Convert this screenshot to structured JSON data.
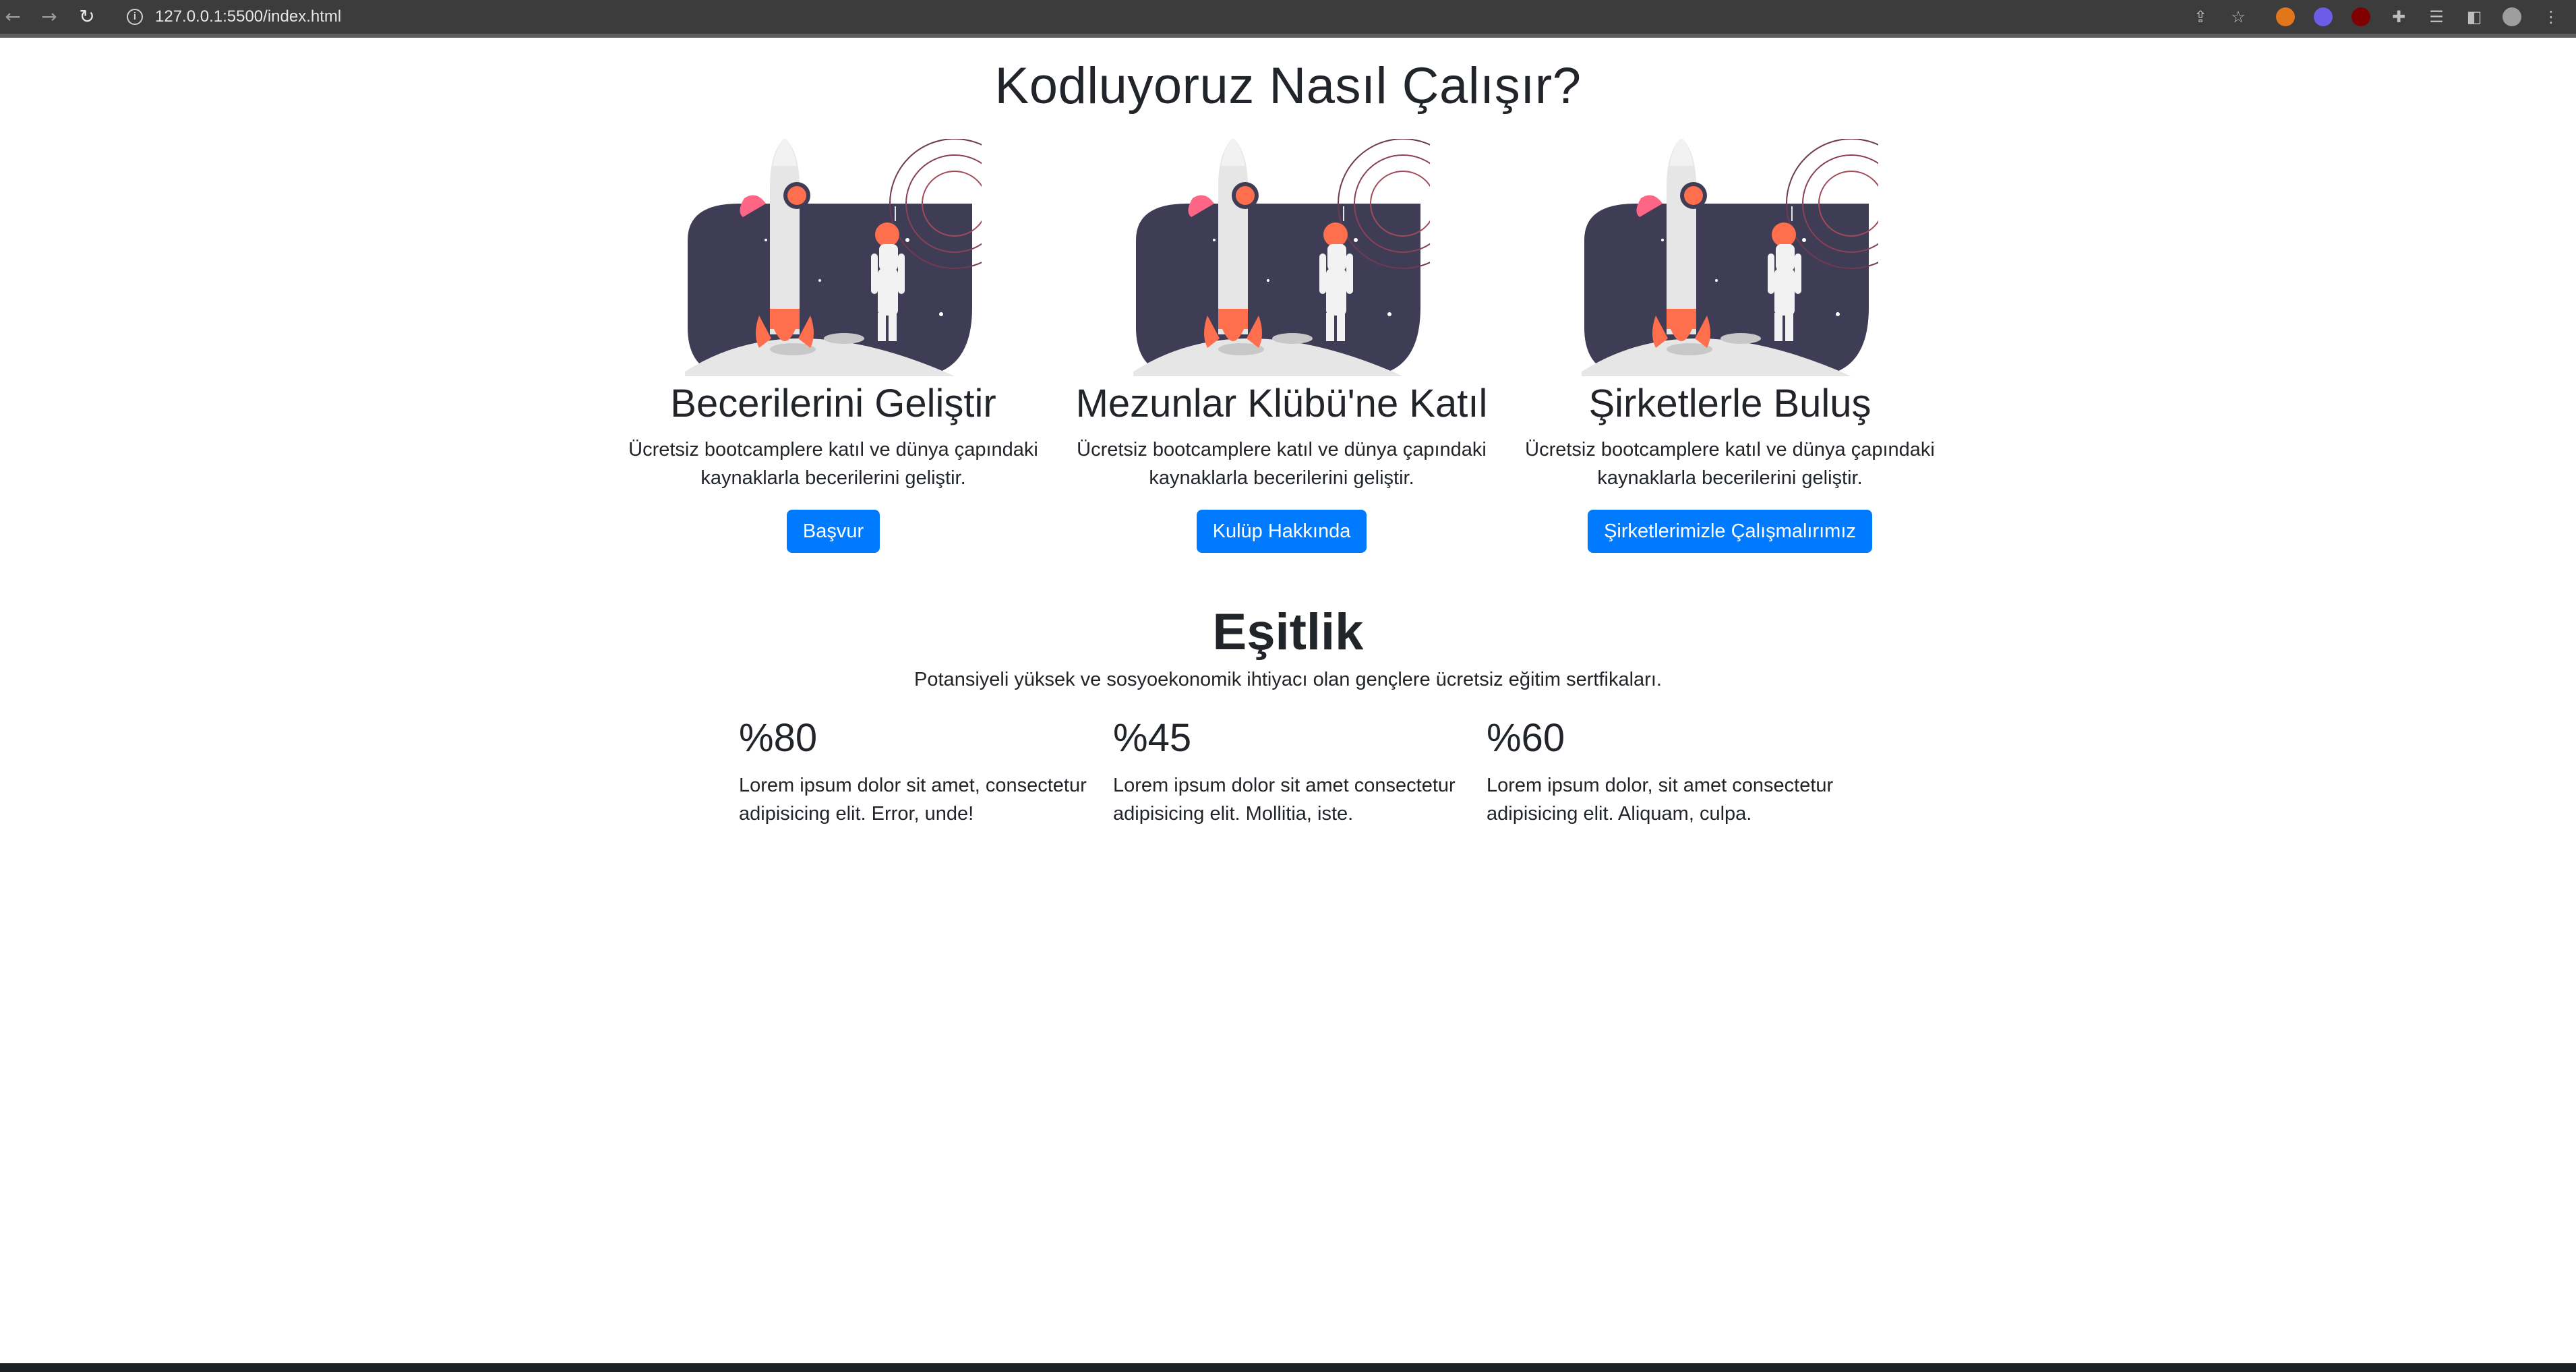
{
  "browser": {
    "url": "127.0.0.1:5500/index.html",
    "icons": [
      "back-icon",
      "forward-icon",
      "reload-icon",
      "info-icon",
      "share-icon",
      "star-icon",
      "extensions-icon",
      "reading-list-icon",
      "side-panel-icon",
      "profile-icon",
      "menu-icon"
    ],
    "glyphs": {
      "back": "←",
      "forward": "→",
      "reload": "↻",
      "info": "i",
      "share": "⇪",
      "star": "☆",
      "extensions": "✚",
      "reading_list": "☰",
      "side_panel": "◧",
      "menu": "⋮"
    }
  },
  "header": {
    "title": "Kodluyoruz Nasıl Çalışır?"
  },
  "cards": [
    {
      "title": "Becerilerini Geliştir",
      "text": "Ücretsiz bootcamplere katıl ve dünya çapındaki kaynaklarla becerilerini geliştir.",
      "button": "Başvur"
    },
    {
      "title": "Mezunlar Klübü'ne Katıl",
      "text": "Ücretsiz bootcamplere katıl ve dünya çapındaki kaynaklarla becerilerini geliştir.",
      "button": "Kulüp Hakkında"
    },
    {
      "title": "Şirketlerle Buluş",
      "text": "Ücretsiz bootcamplere katıl ve dünya çapındaki kaynaklarla becerilerini geliştir.",
      "button": "Şirketlerimizle Çalışmalırımız"
    }
  ],
  "equality": {
    "title": "Eşitlik",
    "subtitle": "Potansiyeli yüksek ve sosyoekonomik ihtiyacı olan gençlere ücretsiz eğitim sertfikaları.",
    "stats": [
      {
        "value": "%80",
        "text": "Lorem ipsum dolor sit amet, consectetur adipisicing elit. Error, unde!"
      },
      {
        "value": "%45",
        "text": "Lorem ipsum dolor sit amet consectetur adipisicing elit. Mollitia, iste."
      },
      {
        "value": "%60",
        "text": "Lorem ipsum dolor, sit amet consectetur adipisicing elit. Aliquam, culpa."
      }
    ]
  },
  "colors": {
    "primary_button": "#007bff",
    "space_bg": "#3f3d56",
    "rocket_accent": "#ff6f4e",
    "moon": "#e6e6e6"
  }
}
